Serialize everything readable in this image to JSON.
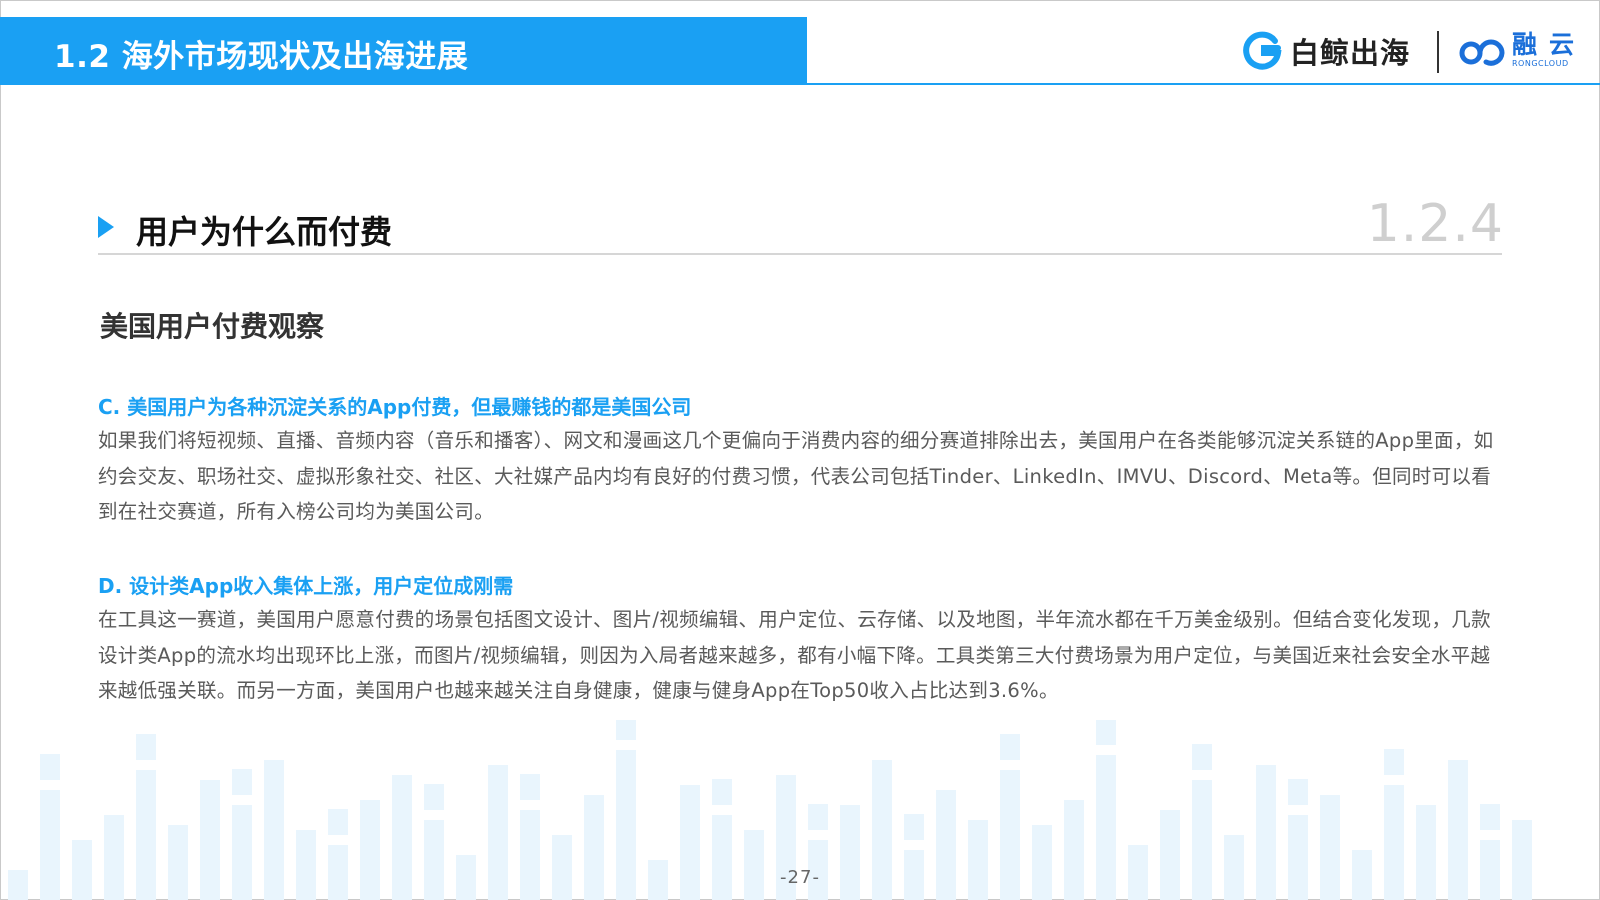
{
  "header": {
    "title": "1.2 海外市场现状及出海进展",
    "logo_baijing": "白鲸出海",
    "logo_rongcloud": "融云",
    "logo_rongcloud_sub": "RONGCLOUD"
  },
  "section": {
    "title": "用户为什么而付费",
    "number": "1.2.4"
  },
  "subtitle": "美国用户付费观察",
  "blocks": [
    {
      "heading": "C. 美国用户为各种沉淀关系的App付费，但最赚钱的都是美国公司",
      "body": "如果我们将短视频、直播、音频内容（音乐和播客）、网文和漫画这几个更偏向于消费内容的细分赛道排除出去，美国用户在各类能够沉淀关系链的App里面，如约会交友、职场社交、虚拟形象社交、社区、大社媒产品内均有良好的付费习惯，代表公司包括Tinder、LinkedIn、IMVU、Discord、Meta等。但同时可以看到在社交赛道，所有入榜公司均为美国公司。"
    },
    {
      "heading": "D. 设计类App收入集体上涨，用户定位成刚需",
      "body": "在工具这一赛道，美国用户愿意付费的场景包括图文设计、图片/视频编辑、用户定位、云存储、以及地图，半年流水都在千万美金级别。但结合变化发现，几款设计类App的流水均出现环比上涨，而图片/视频编辑，则因为入局者越来越多，都有小幅下降。工具类第三大付费场景为用户定位，与美国近来社会安全水平越来越低强关联。而另一方面，美国用户也越来越关注自身健康，健康与健身App在Top50收入占比达到3.6%。"
    }
  ],
  "page_number": "-27-",
  "colors": {
    "accent": "#1aa0f3",
    "bar_light": "#e9f5fd",
    "rongcloud_blue": "#1b6fd9"
  }
}
